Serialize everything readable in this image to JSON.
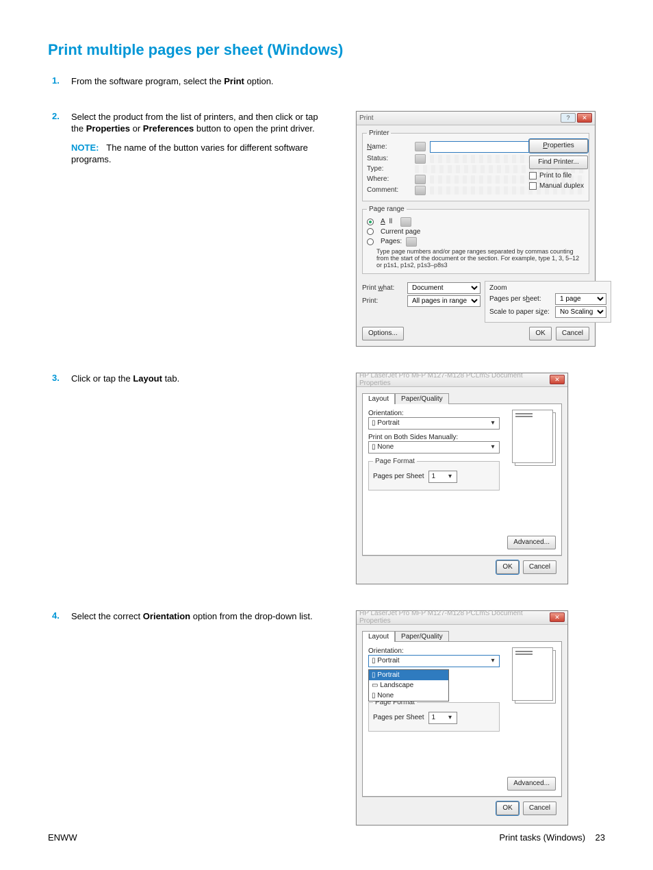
{
  "title": "Print multiple pages per sheet (Windows)",
  "steps": {
    "s1": {
      "num": "1.",
      "a": "From the software program, select the ",
      "b": "Print",
      "c": " option."
    },
    "s2": {
      "num": "2.",
      "a": "Select the product from the list of printers, and then click or tap the ",
      "b1": "Properties",
      "mid": " or ",
      "b2": "Preferences",
      "c": " button to open the print driver."
    },
    "s2note": {
      "label": "NOTE:",
      "text": "The name of the button varies for different software programs."
    },
    "s3": {
      "num": "3.",
      "a": "Click or tap the ",
      "b": "Layout",
      "c": " tab."
    },
    "s4": {
      "num": "4.",
      "a": "Select the correct ",
      "b": "Orientation",
      "c": " option from the drop-down list."
    }
  },
  "print_dialog": {
    "title": "Print",
    "printer_legend": "Printer",
    "name_label": "Name:",
    "status_label": "Status:",
    "type_label": "Type:",
    "where_label": "Where:",
    "comment_label": "Comment:",
    "properties_btn": "Properties",
    "find_printer_btn": "Find Printer...",
    "print_to_file": "Print to file",
    "manual_duplex": "Manual duplex",
    "page_range_legend": "Page range",
    "all": "All",
    "current": "Current page",
    "pages": "Pages:",
    "pages_hint1": "Type page numbers and/or page ranges separated by commas counting from the start of the document or the section. For example, type 1, 3, 5–12 or p1s1, p1s2, p1s3–p8s3",
    "print_what_label": "Print what:",
    "print_what_val": "Document",
    "print_label": "Print:",
    "print_val": "All pages in range",
    "zoom_legend": "Zoom",
    "pps_label": "Pages per sheet:",
    "pps_val": "1 page",
    "scale_label": "Scale to paper size:",
    "scale_val": "No Scaling",
    "options_btn": "Options...",
    "ok": "OK",
    "cancel": "Cancel"
  },
  "props": {
    "title": "HP LaserJet Pro MFP M127-M128 PCLmS Document Properties",
    "tab_layout": "Layout",
    "tab_pq": "Paper/Quality",
    "orientation_label": "Orientation:",
    "orientation_val": "Portrait",
    "both_sides_label": "Print on Both Sides Manually:",
    "both_sides_val": "None",
    "page_format_legend": "Page Format",
    "pps_label": "Pages per Sheet",
    "pps_val": "1",
    "advanced_btn": "Advanced...",
    "ok": "OK",
    "cancel": "Cancel",
    "orientation_options": {
      "portrait": "Portrait",
      "landscape": "Landscape",
      "none": "None"
    }
  },
  "footer": {
    "left": "ENWW",
    "right_text": "Print tasks (Windows)",
    "page": "23"
  }
}
